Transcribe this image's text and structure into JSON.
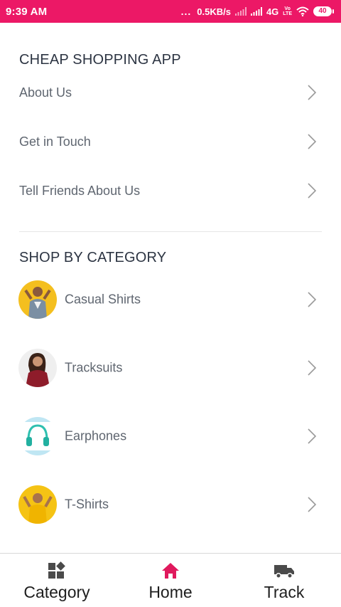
{
  "status_bar": {
    "time": "9:39 AM",
    "dots": "...",
    "speed": "0.5KB/s",
    "network": "4G",
    "volte_top": "Vo",
    "volte_bottom": "LTE",
    "battery": "40",
    "icons": [
      "signal-icon",
      "signal-icon",
      "wifi-icon",
      "battery-icon"
    ]
  },
  "app_section": {
    "title": "CHEAP SHOPPING APP",
    "items": [
      {
        "label": "About Us"
      },
      {
        "label": "Get in Touch"
      },
      {
        "label": "Tell Friends About Us"
      }
    ]
  },
  "category_section": {
    "title": "SHOP BY CATEGORY",
    "items": [
      {
        "label": "Casual Shirts",
        "thumb_color": "#f4bf1f"
      },
      {
        "label": "Tracksuits",
        "thumb_color": "#efefef"
      },
      {
        "label": "Earphones",
        "thumb_color": "#bfe6f3"
      },
      {
        "label": "T-Shirts",
        "thumb_color": "#f5c314"
      }
    ]
  },
  "bottom_nav": {
    "active_color": "#e0195d",
    "items": [
      {
        "label": "Category",
        "icon": "category-grid-icon"
      },
      {
        "label": "Home",
        "icon": "home-icon",
        "active": true
      },
      {
        "label": "Track",
        "icon": "truck-icon"
      }
    ]
  }
}
